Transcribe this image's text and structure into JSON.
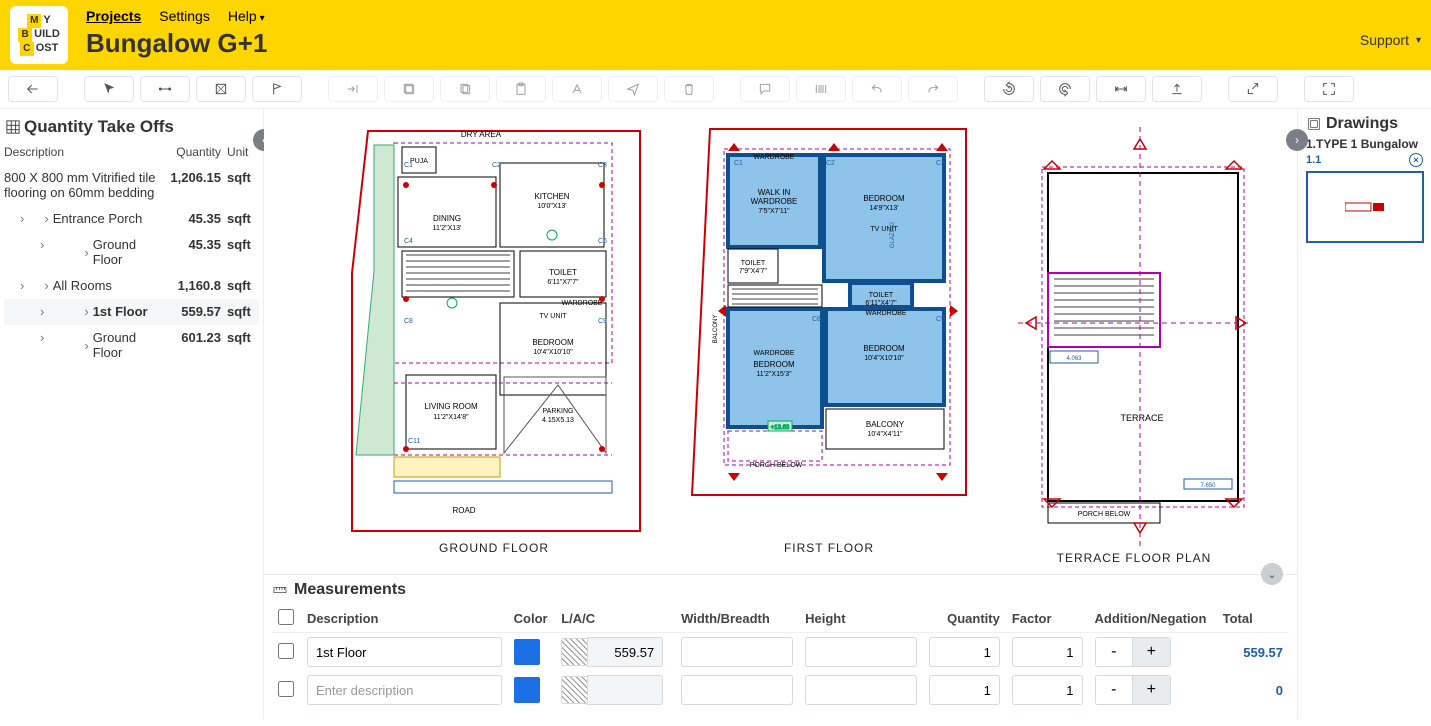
{
  "header": {
    "nav": {
      "projects": "Projects",
      "settings": "Settings",
      "help": "Help"
    },
    "title": "Bungalow G+1",
    "support": "Support"
  },
  "qto": {
    "title": "Quantity Take Offs",
    "headers": {
      "desc": "Description",
      "qty": "Quantity",
      "unit": "Unit"
    },
    "rows": [
      {
        "desc": "800 X 800 mm Vitrified tile flooring on 60mm bedding",
        "qty": "1,206.15",
        "unit": "sqft",
        "cls": "top"
      },
      {
        "desc": "Entrance Porch",
        "qty": "45.35",
        "unit": "sqft",
        "cls": "ind1 chev"
      },
      {
        "desc": "Ground Floor",
        "qty": "45.35",
        "unit": "sqft",
        "cls": "ind2 chev"
      },
      {
        "desc": "All Rooms",
        "qty": "1,160.8",
        "unit": "sqft",
        "cls": "ind1 chev"
      },
      {
        "desc": "1st Floor",
        "qty": "559.57",
        "unit": "sqft",
        "cls": "ind2 chev hl"
      },
      {
        "desc": "Ground Floor",
        "qty": "601.23",
        "unit": "sqft",
        "cls": "ind2 chev"
      }
    ]
  },
  "measurements": {
    "title": "Measurements",
    "headers": {
      "desc": "Description",
      "color": "Color",
      "lac": "L/A/C",
      "wb": "Width/Breadth",
      "h": "Height",
      "qty": "Quantity",
      "factor": "Factor",
      "an": "Addition/Negation",
      "total": "Total"
    },
    "rows": [
      {
        "desc": "1st Floor",
        "lac": "559.57",
        "wb": "",
        "h": "",
        "qty": "1",
        "factor": "1",
        "pm": "+",
        "total": "559.57"
      },
      {
        "desc": "",
        "placeholder": "Enter description",
        "lac": "",
        "wb": "",
        "h": "",
        "qty": "1",
        "factor": "1",
        "pm": "+",
        "total": "0"
      }
    ]
  },
  "drawings": {
    "title": "Drawings",
    "project": "1.TYPE 1 Bungalow",
    "sheet": "1.1"
  },
  "plans": {
    "ground": "GROUND  FLOOR",
    "first": "FIRST  FLOOR",
    "terrace": "TERRACE  FLOOR  PLAN"
  }
}
